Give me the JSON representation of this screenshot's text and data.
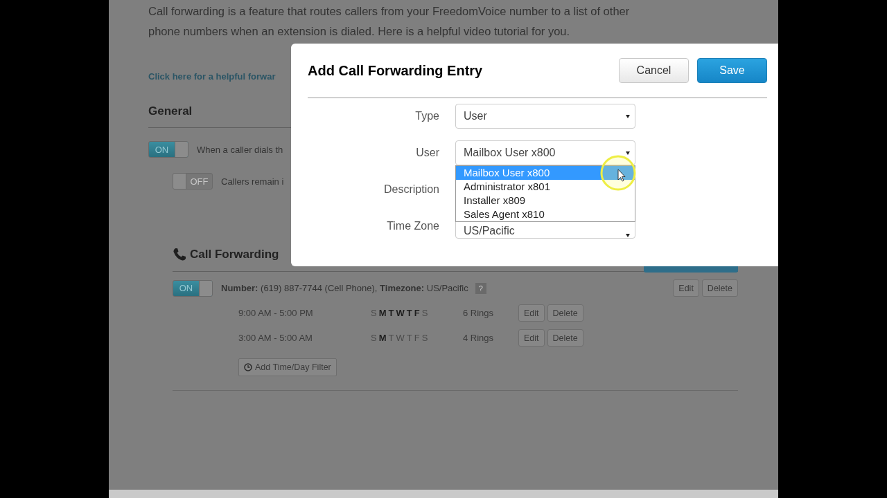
{
  "intro": {
    "text": "Call forwarding is a feature that routes callers from your FreedomVoice number to a list of other phone numbers when an extension is dialed. Here is a helpful video tutorial for you.",
    "link": "Click here for a helpful forwar"
  },
  "general": {
    "title": "General",
    "toggles": [
      {
        "text": "ON",
        "on": true,
        "label": "When a caller dials th",
        "children": [
          {
            "text": "OFF",
            "on": false,
            "label": "Callers remain i"
          }
        ]
      }
    ]
  },
  "call_forwarding": {
    "title": "Call Forwarding",
    "entry": {
      "toggle": {
        "text": "ON",
        "on": true
      },
      "summary": "**Number:** (619) 887-7744 (Cell Phone), **Timezone:** US/Pacific",
      "help": "?",
      "buttons": [
        "Edit",
        "Delete"
      ]
    },
    "filters": [
      {
        "time": "9:00 AM - 5:00 PM",
        "days": [
          {
            "letter": "S",
            "active": false
          },
          {
            "letter": "M",
            "active": true
          },
          {
            "letter": "T",
            "active": true
          },
          {
            "letter": "W",
            "active": true
          },
          {
            "letter": "T",
            "active": true
          },
          {
            "letter": "F",
            "active": true
          },
          {
            "letter": "S",
            "active": false
          }
        ],
        "rings": "6 Rings",
        "buttons": [
          "Edit",
          "Delete"
        ]
      },
      {
        "time": "3:00 AM - 5:00 AM",
        "days": [
          {
            "letter": "S",
            "active": false
          },
          {
            "letter": "M",
            "active": true
          },
          {
            "letter": "T",
            "active": false
          },
          {
            "letter": "W",
            "active": false
          },
          {
            "letter": "T",
            "active": false
          },
          {
            "letter": "F",
            "active": false
          },
          {
            "letter": "S",
            "active": false
          }
        ],
        "rings": "4 Rings",
        "buttons": [
          "Edit",
          "Delete"
        ]
      }
    ],
    "add_filter": "Add Time/Day Filter"
  },
  "dialog": {
    "title": "Add Call Forwarding Entry",
    "cancel": "Cancel",
    "save": "Save",
    "fields": [
      {
        "label": "Type",
        "value": "User",
        "kind": "select"
      },
      {
        "label": "User",
        "value": "Mailbox User x800",
        "kind": "select",
        "expanded": true,
        "options": [
          {
            "text": "Mailbox User x800",
            "selected": true
          },
          {
            "text": "Administrator x801",
            "selected": false
          },
          {
            "text": "Installer x809",
            "selected": false
          },
          {
            "text": "Sales Agent x810",
            "selected": false
          }
        ]
      },
      {
        "label": "Description",
        "kind": "hidden"
      },
      {
        "label": "Time Zone",
        "value": "US/Pacific",
        "kind": "select"
      }
    ]
  }
}
